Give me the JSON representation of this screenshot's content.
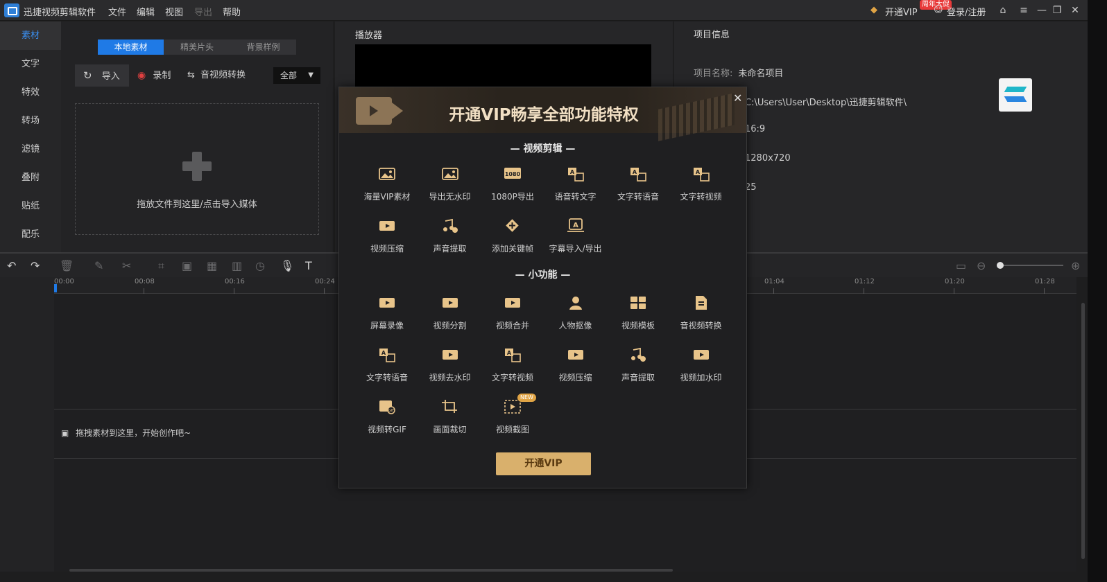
{
  "app": {
    "title": "迅捷视频剪辑软件",
    "menu": [
      "文件",
      "编辑",
      "视图",
      "导出",
      "帮助"
    ],
    "vip_label": "开通VIP",
    "promo_badge": "周年大促",
    "login_label": "登录/注册"
  },
  "sidebar": {
    "items": [
      {
        "label": "素材",
        "active": true
      },
      {
        "label": "文字"
      },
      {
        "label": "特效"
      },
      {
        "label": "转场"
      },
      {
        "label": "滤镜"
      },
      {
        "label": "叠附"
      },
      {
        "label": "贴纸"
      },
      {
        "label": "配乐"
      }
    ]
  },
  "media": {
    "tabs": [
      "本地素材",
      "精美片头",
      "背景样例"
    ],
    "import_label": "导入",
    "record_label": "录制",
    "convert_label": "音视频转换",
    "filter_value": "全部",
    "drop_text": "拖放文件到这里/点击导入媒体"
  },
  "player": {
    "title": "播放器"
  },
  "project": {
    "title": "项目信息",
    "name_label": "项目名称:",
    "name_value": "未命名项目",
    "path_value": "C:\\Users\\User\\Desktop\\迅捷剪辑软件\\",
    "ratio_value": "16:9",
    "resolution_value": "1280x720",
    "fps_value": "25"
  },
  "timeline": {
    "ticks": [
      "00:00",
      "00:08",
      "00:16",
      "00:24",
      "01:04",
      "01:12",
      "01:20",
      "01:28"
    ],
    "drag_hint": "拖拽素材到这里，开始创作吧~"
  },
  "modal": {
    "banner_title": "开通VIP畅享全部功能特权",
    "section1_title": "—  视频剪辑  —",
    "section1": [
      {
        "label": "海量VIP素材",
        "icon": "image-icon"
      },
      {
        "label": "导出无水印",
        "icon": "no-watermark-icon"
      },
      {
        "label": "1080P导出",
        "icon": "hd-1080-icon",
        "glyph": "1080"
      },
      {
        "label": "语音转文字",
        "icon": "speech-to-text-icon"
      },
      {
        "label": "文字转语音",
        "icon": "text-to-speech-icon"
      },
      {
        "label": "文字转视频",
        "icon": "text-to-video-icon"
      },
      {
        "label": "视频压缩",
        "icon": "video-compress-icon"
      },
      {
        "label": "声音提取",
        "icon": "audio-extract-icon"
      },
      {
        "label": "添加关键帧",
        "icon": "keyframe-icon"
      },
      {
        "label": "字幕导入/导出",
        "icon": "subtitle-icon"
      }
    ],
    "section2_title": "—  小功能  —",
    "section2": [
      {
        "label": "屏幕录像",
        "icon": "screen-record-icon"
      },
      {
        "label": "视频分割",
        "icon": "video-split-icon"
      },
      {
        "label": "视频合并",
        "icon": "video-merge-icon"
      },
      {
        "label": "人物抠像",
        "icon": "portrait-cutout-icon"
      },
      {
        "label": "视频模板",
        "icon": "video-template-icon"
      },
      {
        "label": "音视频转换",
        "icon": "av-convert-icon"
      },
      {
        "label": "文字转语音",
        "icon": "text-to-speech-icon"
      },
      {
        "label": "视频去水印",
        "icon": "remove-watermark-icon"
      },
      {
        "label": "文字转视频",
        "icon": "text-to-video-icon"
      },
      {
        "label": "视频压缩",
        "icon": "video-compress-icon"
      },
      {
        "label": "声音提取",
        "icon": "audio-extract-icon"
      },
      {
        "label": "视频加水印",
        "icon": "add-watermark-icon"
      },
      {
        "label": "视频转GIF",
        "icon": "video-to-gif-icon"
      },
      {
        "label": "画面裁切",
        "icon": "crop-icon"
      },
      {
        "label": "视频截图",
        "icon": "screenshot-icon",
        "badge": "NEW"
      }
    ],
    "cta_label": "开通VIP"
  },
  "colors": {
    "accent": "#1f7ae6",
    "gold": "#d9b06c",
    "icon_gold": "#e8c48a"
  }
}
